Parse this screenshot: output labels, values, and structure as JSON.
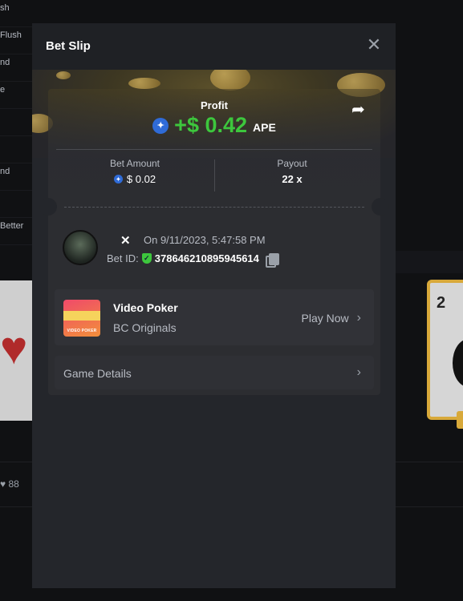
{
  "background": {
    "list_items": [
      "sh",
      "Flush",
      "nd",
      "e",
      "",
      "",
      "nd",
      "",
      "Better"
    ],
    "likes_count": "88",
    "card_rank": "2"
  },
  "modal": {
    "title": "Bet Slip",
    "close_icon": "close-icon",
    "share_icon": "share-icon",
    "profit": {
      "label": "Profit",
      "value": "+$ 0.42",
      "currency": "APE",
      "color": "#3dc73d"
    },
    "bet_amount": {
      "label": "Bet Amount",
      "value": "$ 0.02"
    },
    "payout": {
      "label": "Payout",
      "value": "22 x"
    },
    "bet": {
      "separator": "✕",
      "time": "On 9/11/2023, 5:47:58 PM",
      "id_label": "Bet ID:",
      "id_value": "378646210895945614"
    },
    "game": {
      "name": "Video Poker",
      "provider": "BC Originals",
      "thumb_label": "VIDEO POKER",
      "action": "Play Now"
    },
    "details": {
      "label": "Game Details"
    }
  }
}
